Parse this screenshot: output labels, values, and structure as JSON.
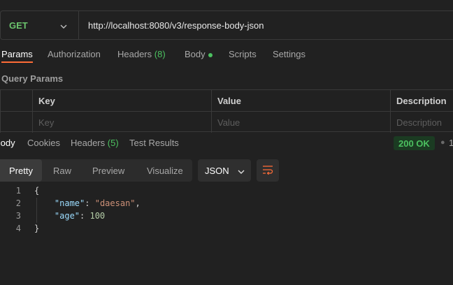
{
  "request": {
    "method": "GET",
    "url": "http://localhost:8080/v3/response-body-json"
  },
  "request_tabs": {
    "params": "Params",
    "authorization": "Authorization",
    "headers_label": "Headers",
    "headers_count": "(8)",
    "body": "Body",
    "scripts": "Scripts",
    "settings": "Settings"
  },
  "query_params": {
    "title": "Query Params",
    "headers": {
      "key": "Key",
      "value": "Value",
      "description": "Description"
    },
    "placeholders": {
      "key": "Key",
      "value": "Value",
      "description": "Description"
    }
  },
  "response_tabs": {
    "body": "Body",
    "cookies": "Cookies",
    "headers_label": "Headers",
    "headers_count": "(5)",
    "test_results": "Test Results",
    "truncated": "1"
  },
  "status": {
    "text": "200 OK",
    "color": "#4cc160"
  },
  "view_modes": {
    "pretty": "Pretty",
    "raw": "Raw",
    "preview": "Preview",
    "visualize": "Visualize"
  },
  "format": "JSON",
  "code": {
    "line_numbers": [
      "1",
      "2",
      "3",
      "4"
    ],
    "open_brace": "{",
    "close_brace": "}",
    "name_key": "\"name\"",
    "name_value": "\"daesan\"",
    "age_key": "\"age\"",
    "age_value": "100"
  },
  "colors": {
    "accent": "#ff6c37",
    "method": "#6bc46d",
    "background": "#212121"
  },
  "icons": {
    "method_dropdown": "chevron-down-icon",
    "format_dropdown": "chevron-down-icon",
    "wrap": "wrap-lines-icon"
  }
}
